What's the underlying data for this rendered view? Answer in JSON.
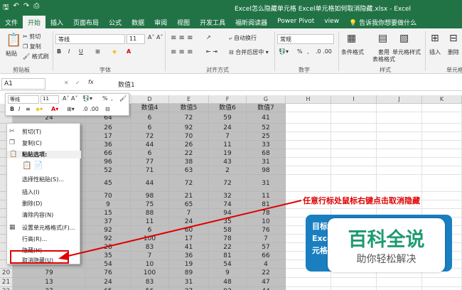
{
  "title": "Excel怎么隐藏单元格 Excel单元格如何取消隐藏.xlsx  -  Excel",
  "tabs": [
    {
      "label": "文件"
    },
    {
      "label": "开始"
    },
    {
      "label": "插入"
    },
    {
      "label": "页面布局"
    },
    {
      "label": "公式"
    },
    {
      "label": "数据"
    },
    {
      "label": "审阅"
    },
    {
      "label": "视图"
    },
    {
      "label": "开发工具"
    },
    {
      "label": "福昕阅读器"
    },
    {
      "label": "Power Pivot"
    },
    {
      "label": "view"
    }
  ],
  "tell_me": "告诉我你想要做什么",
  "ribbon": {
    "paste": "粘贴",
    "cut": "剪切",
    "copy": "复制",
    "format_painter": "格式刷",
    "font_name": "等线",
    "font_size": "11",
    "wrap_text": "自动换行",
    "merge_center": "合并后居中",
    "number_format": "常规",
    "percent": "%",
    "cond_format": "条件格式",
    "table_format_1": "套用",
    "table_format_2": "表格格式",
    "cell_style": "单元格样式",
    "insert": "插入",
    "delete": "删除",
    "groups": {
      "clipboard": "剪贴板",
      "font": "字体",
      "alignment": "对齐方式",
      "number": "数字",
      "styles": "样式",
      "cells": "单元格"
    }
  },
  "formula_bar": {
    "name_box": "A1",
    "fx": "fx",
    "value": "数值1"
  },
  "columns": [
    "A",
    "B",
    "C",
    "D",
    "E",
    "F",
    "G",
    "H",
    "I",
    "J",
    "K"
  ],
  "table": {
    "headers": [
      "数值4",
      "数值5",
      "数值6",
      "数值7"
    ],
    "rows": [
      {
        "num": "",
        "b": "24",
        "c": "64",
        "d": "6",
        "e": "72",
        "f": "59",
        "g": "41"
      },
      {
        "num": "",
        "b": "",
        "c": "26",
        "d": "6",
        "e": "92",
        "f": "24",
        "g": "52"
      },
      {
        "num": "",
        "b": "",
        "c": "17",
        "d": "72",
        "e": "70",
        "f": "7",
        "g": "25"
      },
      {
        "num": "",
        "b": "",
        "c": "36",
        "d": "44",
        "e": "26",
        "f": "11",
        "g": "33"
      },
      {
        "num": "",
        "b": "",
        "c": "66",
        "d": "6",
        "e": "22",
        "f": "19",
        "g": "68"
      },
      {
        "num": "",
        "b": "",
        "c": "96",
        "d": "77",
        "e": "38",
        "f": "43",
        "g": "31"
      },
      {
        "num": "",
        "b": "",
        "c": "52",
        "d": "71",
        "e": "63",
        "f": "2",
        "g": "98"
      },
      {
        "num": "",
        "b": "",
        "c": "45",
        "d": "44",
        "e": "72",
        "f": "72",
        "g": "31"
      },
      {
        "num": "",
        "b": "",
        "c": "70",
        "d": "98",
        "e": "21",
        "f": "32",
        "g": "11"
      },
      {
        "num": "",
        "b": "",
        "c": "9",
        "d": "75",
        "e": "65",
        "f": "74",
        "g": "81"
      },
      {
        "num": "",
        "b": "",
        "c": "15",
        "d": "88",
        "e": "7",
        "f": "94",
        "g": "78"
      },
      {
        "num": "",
        "b": "",
        "c": "37",
        "d": "11",
        "e": "24",
        "f": "35",
        "g": "10"
      },
      {
        "num": "",
        "b": "",
        "c": "92",
        "d": "6",
        "e": "60",
        "f": "58",
        "g": "76"
      },
      {
        "num": "",
        "b": "",
        "c": "92",
        "d": "100",
        "e": "17",
        "f": "78",
        "g": "7"
      },
      {
        "num": "",
        "b": "",
        "c": "28",
        "d": "83",
        "e": "41",
        "f": "22",
        "g": "57"
      },
      {
        "num": "",
        "b": "",
        "c": "35",
        "d": "7",
        "e": "36",
        "f": "81",
        "g": "66"
      },
      {
        "num": "",
        "b": "",
        "c": "54",
        "d": "10",
        "e": "19",
        "f": "54",
        "g": "4"
      },
      {
        "num": "20",
        "b": "79",
        "c": "76",
        "d": "100",
        "e": "89",
        "f": "9",
        "g": "22"
      },
      {
        "num": "21",
        "b": "13",
        "c": "24",
        "d": "83",
        "e": "31",
        "f": "48",
        "g": "47"
      },
      {
        "num": "22",
        "b": "37",
        "c": "65",
        "d": "56",
        "e": "27",
        "f": "93",
        "g": "44"
      }
    ]
  },
  "mini_toolbar": {
    "font": "等线",
    "size": "11",
    "percent": "%"
  },
  "context_menu": [
    {
      "label": "剪切(T)",
      "icon": "scissors-icon"
    },
    {
      "label": "复制(C)",
      "icon": "copy-icon"
    },
    {
      "label": "粘贴选项:",
      "icon": "paste-icon"
    },
    {
      "label": "",
      "icon": "paste-options-icon"
    },
    {
      "label": "选择性粘贴(S)...",
      "icon": ""
    },
    {
      "label": "插入(I)",
      "icon": ""
    },
    {
      "label": "删除(D)",
      "icon": ""
    },
    {
      "label": "清除内容(N)",
      "icon": ""
    },
    {
      "label": "设置单元格格式(F)...",
      "icon": "format-cells-icon"
    },
    {
      "label": "行高(R)...",
      "icon": ""
    },
    {
      "label": "隐藏(H)",
      "icon": ""
    },
    {
      "label": "取消隐藏(U)",
      "icon": ""
    }
  ],
  "annotation": "任意行标处鼠标右键点击取消隐藏",
  "banner": {
    "line1": "目标",
    "line2": "Excel",
    "line3": "元格",
    "big": "百科全说",
    "small": "助你轻松解决"
  },
  "colors": {
    "excel_green": "#217346",
    "annotation_red": "#e00000",
    "banner_blue": "#1a7fc1",
    "logo_green": "#1f9a72"
  }
}
